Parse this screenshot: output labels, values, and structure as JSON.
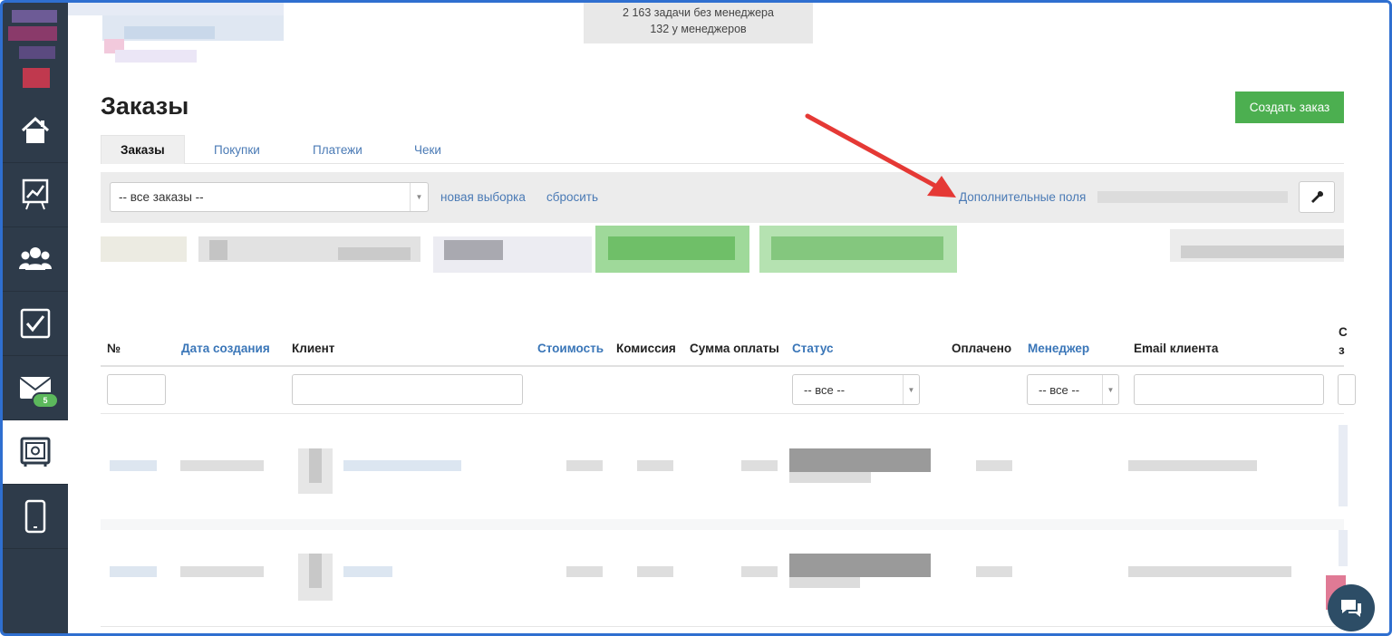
{
  "header": {
    "tasks_without_manager": "2 163 задачи без менеджера",
    "tasks_with_managers": "132 у менеджеров"
  },
  "page": {
    "title": "Заказы",
    "create_button": "Создать заказ"
  },
  "tabs": [
    {
      "label": "Заказы",
      "active": true
    },
    {
      "label": "Покупки",
      "active": false
    },
    {
      "label": "Платежи",
      "active": false
    },
    {
      "label": "Чеки",
      "active": false
    }
  ],
  "filters": {
    "selection_value": "-- все заказы --",
    "new_selection_link": "новая выборка",
    "reset_link": "сбросить",
    "extra_fields_link": "Дополнительные поля"
  },
  "table": {
    "columns": [
      {
        "label": "№",
        "sortable": false
      },
      {
        "label": "Дата создания",
        "sortable": true
      },
      {
        "label": "Клиент",
        "sortable": false
      },
      {
        "label": "Стоимость",
        "sortable": true
      },
      {
        "label": "Комиссия",
        "sortable": false
      },
      {
        "label": "Сумма оплаты",
        "sortable": false
      },
      {
        "label": "Статус",
        "sortable": true
      },
      {
        "label": "Оплачено",
        "sortable": false
      },
      {
        "label": "Менеджер",
        "sortable": true
      },
      {
        "label": "Email клиента",
        "sortable": false
      },
      {
        "label": "С з",
        "sortable": false
      }
    ],
    "status_filter": "-- все --",
    "manager_filter": "-- все --"
  },
  "sidebar": {
    "items": [
      {
        "icon": "home-icon"
      },
      {
        "icon": "chart-board-icon"
      },
      {
        "icon": "users-icon"
      },
      {
        "icon": "checkbox-icon"
      },
      {
        "icon": "mail-icon",
        "badge": "5"
      },
      {
        "icon": "safe-icon",
        "active": true
      },
      {
        "icon": "mobile-icon"
      }
    ]
  },
  "colors": {
    "sidebar_bg": "#2e3b4a",
    "accent_green": "#4caf50",
    "link_blue": "#4a7ab5",
    "arrow_red": "#e53935"
  }
}
